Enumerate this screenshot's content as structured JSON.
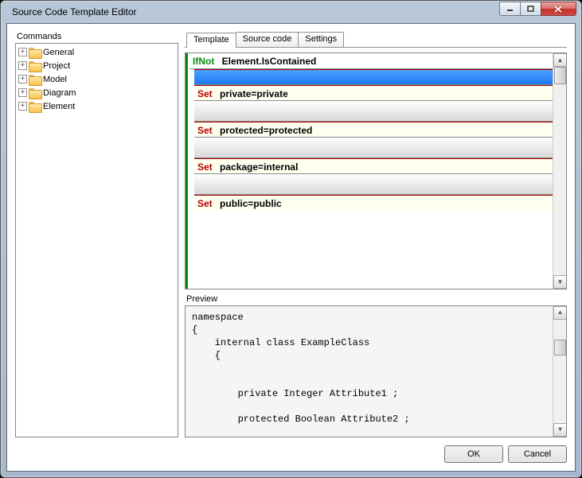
{
  "window": {
    "title": "Source Code Template Editor"
  },
  "commands": {
    "label": "Commands",
    "items": [
      {
        "label": "General"
      },
      {
        "label": "Project"
      },
      {
        "label": "Model"
      },
      {
        "label": "Diagram"
      },
      {
        "label": "Element"
      }
    ]
  },
  "tabs": [
    {
      "label": "Template",
      "active": true
    },
    {
      "label": "Source code",
      "active": false
    },
    {
      "label": "Settings",
      "active": false
    }
  ],
  "template": {
    "header_keyword": "IfNot",
    "header_expr": "Element.IsContained",
    "rows": [
      {
        "keyword": "Set",
        "expr": "private=private"
      },
      {
        "keyword": "Set",
        "expr": "protected=protected"
      },
      {
        "keyword": "Set",
        "expr": "package=internal"
      },
      {
        "keyword": "Set",
        "expr": "public=public"
      }
    ]
  },
  "preview": {
    "label": "Preview",
    "text": "namespace \n{\n    internal class ExampleClass\n    {\n\n\n        private Integer Attribute1 ;\n\n        protected Boolean Attribute2 ;"
  },
  "buttons": {
    "ok": "OK",
    "cancel": "Cancel"
  }
}
